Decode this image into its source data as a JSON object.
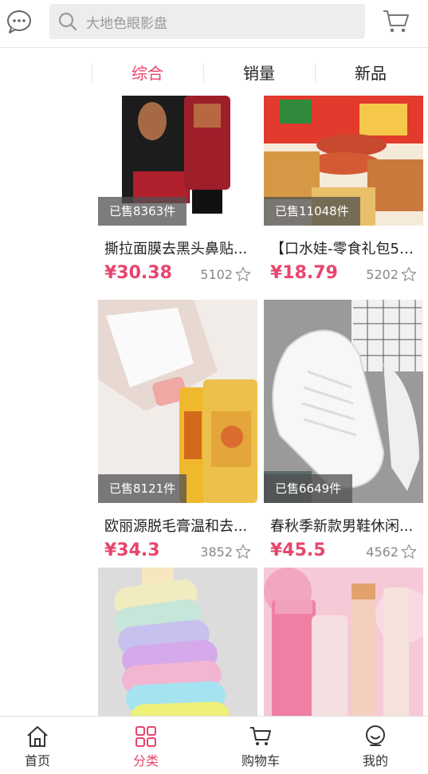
{
  "header": {
    "search_placeholder": "大地色眼影盘"
  },
  "tabs": [
    {
      "label": "综合",
      "active": true
    },
    {
      "label": "销量",
      "active": false
    },
    {
      "label": "新品",
      "active": false
    }
  ],
  "products": [
    {
      "sold": "已售8363件",
      "title": "撕拉面膜去黑头鼻贴...",
      "price": "¥30.38",
      "likes": "5102"
    },
    {
      "sold": "已售11048件",
      "title": "【口水娃-零食礼包50...",
      "price": "¥18.79",
      "likes": "5202"
    },
    {
      "sold": "已售8121件",
      "title": "欧丽源脱毛膏温和去...",
      "price": "¥34.3",
      "likes": "3852"
    },
    {
      "sold": "已售6649件",
      "title": "春秋季新款男鞋休闲...",
      "price": "¥45.5",
      "likes": "4562"
    }
  ],
  "nav": [
    {
      "label": "首页",
      "icon": "home-icon",
      "active": false
    },
    {
      "label": "分类",
      "icon": "category-icon",
      "active": true
    },
    {
      "label": "购物车",
      "icon": "cart-icon",
      "active": false
    },
    {
      "label": "我的",
      "icon": "profile-icon",
      "active": false
    }
  ],
  "colors": {
    "accent": "#e8456c",
    "text": "#222222",
    "muted": "#888888"
  }
}
